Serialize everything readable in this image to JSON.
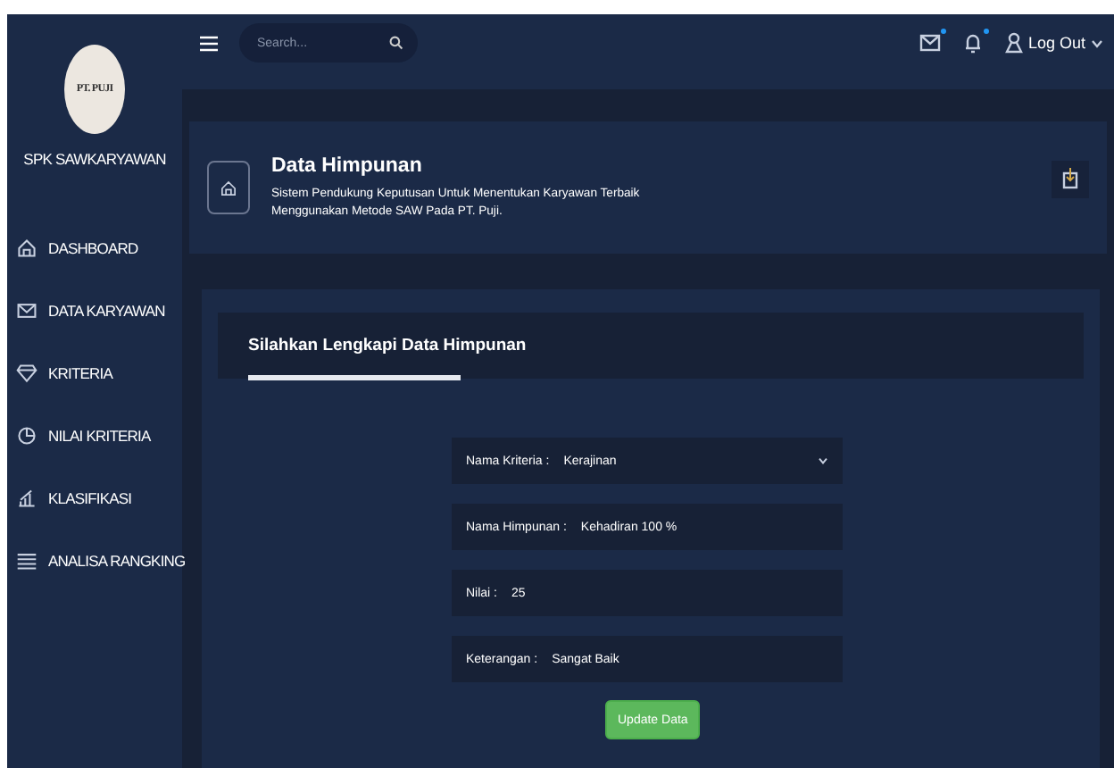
{
  "sidebar": {
    "logo": "PT. PUJI",
    "app_name": "SPK SAWKARYAWAN",
    "items": [
      {
        "label": "DASHBOARD"
      },
      {
        "label": "DATA KARYAWAN"
      },
      {
        "label": "KRITERIA"
      },
      {
        "label": "NILAI KRITERIA"
      },
      {
        "label": "KLASIFIKASI"
      },
      {
        "label": "ANALISA RANGKING"
      }
    ]
  },
  "topbar": {
    "search": {
      "placeholder": "Search..."
    },
    "icons": [
      {
        "kind": "mail",
        "unread": true
      },
      {
        "kind": "bell",
        "unread": true
      }
    ],
    "user_menu": "Log Out"
  },
  "page_header": {
    "title": "Data Himpunan",
    "subtitle": "Sistem Pendukung Keputusan Untuk Menentukan Karyawan Terbaik",
    "subtitle_2": "Menggunakan Metode SAW Pada PT. Puji."
  },
  "form": {
    "title": "Silahkan Lengkapi Data Himpunan",
    "fields": [
      {
        "kind": "select",
        "label": "Nama Kriteria :",
        "value": "Kerajinan"
      },
      {
        "kind": "input",
        "label": "Nama Himpunan :",
        "value": "Kehadiran 100 %"
      },
      {
        "kind": "input",
        "label": "Nilai :",
        "value": "25"
      },
      {
        "kind": "input",
        "label": "Keterangan :",
        "value": "Sangat Baik"
      }
    ],
    "submit": "Update Data"
  }
}
